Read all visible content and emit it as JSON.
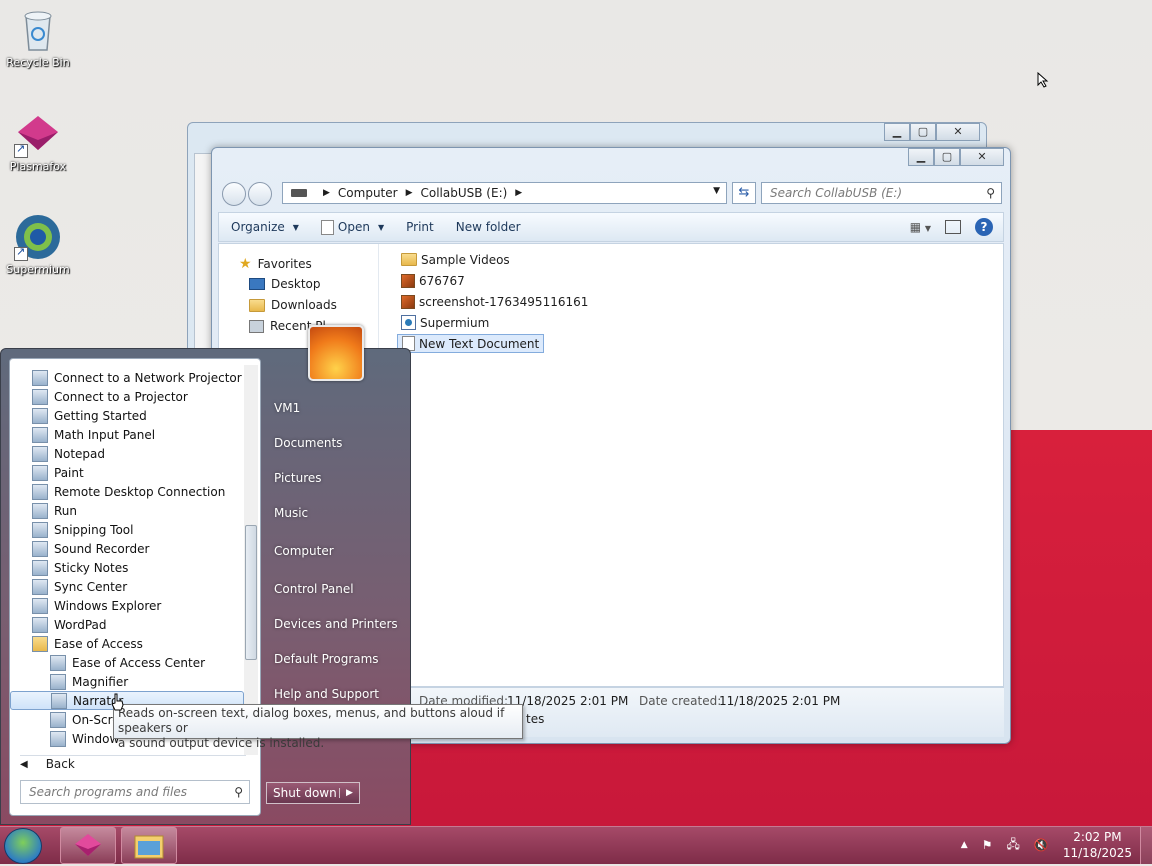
{
  "desktop": {
    "icons": [
      {
        "label": "Recycle Bin"
      },
      {
        "label": "Plasmafox"
      },
      {
        "label": "Supermium"
      }
    ]
  },
  "explorer": {
    "address": {
      "parts": [
        "Computer",
        "CollabUSB (E:)"
      ]
    },
    "search_placeholder": "Search CollabUSB (E:)",
    "toolbar": {
      "organize": "Organize",
      "open": "Open",
      "print": "Print",
      "new_folder": "New folder"
    },
    "nav": {
      "favorites": "Favorites",
      "desktop": "Desktop",
      "downloads": "Downloads",
      "recent": "Recent Pl..."
    },
    "files": [
      {
        "name": "Sample Videos",
        "icon": "folder-icon"
      },
      {
        "name": "676767",
        "icon": "image-file-icon"
      },
      {
        "name": "screenshot-1763495116161",
        "icon": "image-file-icon"
      },
      {
        "name": "Supermium",
        "icon": "shortcut-icon"
      },
      {
        "name": "New Text Document",
        "icon": "text-document-icon",
        "selected": true
      }
    ],
    "details": {
      "date_modified_label": "Date modified:",
      "date_modified": "11/18/2025 2:01 PM",
      "date_created_label": "Date created:",
      "date_created": "11/18/2025 2:01 PM",
      "partial_text": "tes"
    }
  },
  "start_menu": {
    "programs": [
      {
        "label": "Connect to a Network Projector",
        "indent": 0
      },
      {
        "label": "Connect to a Projector",
        "indent": 0
      },
      {
        "label": "Getting Started",
        "indent": 0
      },
      {
        "label": "Math Input Panel",
        "indent": 0
      },
      {
        "label": "Notepad",
        "indent": 0
      },
      {
        "label": "Paint",
        "indent": 0
      },
      {
        "label": "Remote Desktop Connection",
        "indent": 0
      },
      {
        "label": "Run",
        "indent": 0
      },
      {
        "label": "Snipping Tool",
        "indent": 0
      },
      {
        "label": "Sound Recorder",
        "indent": 0
      },
      {
        "label": "Sticky Notes",
        "indent": 0
      },
      {
        "label": "Sync Center",
        "indent": 0
      },
      {
        "label": "Windows Explorer",
        "indent": 0
      },
      {
        "label": "WordPad",
        "indent": 0
      },
      {
        "label": "Ease of Access",
        "indent": 0
      },
      {
        "label": "Ease of Access Center",
        "indent": 1
      },
      {
        "label": "Magnifier",
        "indent": 1
      },
      {
        "label": "Narrator",
        "indent": 1,
        "selected": true
      },
      {
        "label": "On-Scre",
        "indent": 1
      },
      {
        "label": "Window",
        "indent": 1
      }
    ],
    "back": "Back",
    "search_placeholder": "Search programs and files",
    "right_items": [
      "VM1",
      "Documents",
      "Pictures",
      "Music",
      "Computer",
      "Control Panel",
      "Devices and Printers",
      "Default Programs",
      "Help and Support"
    ],
    "shutdown": "Shut down"
  },
  "tooltip": {
    "line1": "Reads on-screen text, dialog boxes, menus, and buttons aloud if speakers or",
    "line2": "a sound output device is installed."
  },
  "taskbar": {
    "time": "2:02 PM",
    "date": "11/18/2025"
  }
}
